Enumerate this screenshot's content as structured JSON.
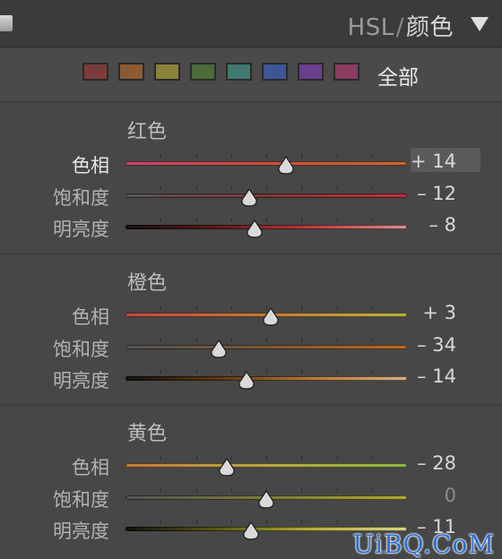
{
  "header": {
    "title_prefix": "HSL",
    "title_sep": "/",
    "title_active": "颜色",
    "collapse_icon": "triangle-down-icon"
  },
  "swatches": [
    {
      "name": "red",
      "color": "#7a3c3a"
    },
    {
      "name": "orange",
      "color": "#8a5a35"
    },
    {
      "name": "yellow",
      "color": "#8a8238"
    },
    {
      "name": "green",
      "color": "#4a6b3a"
    },
    {
      "name": "aqua",
      "color": "#3f7a70"
    },
    {
      "name": "blue",
      "color": "#3d5696"
    },
    {
      "name": "purple",
      "color": "#6a3f8c"
    },
    {
      "name": "magenta",
      "color": "#8a3d60"
    }
  ],
  "all_label": "全部",
  "sections": [
    {
      "title": "红色",
      "rows": [
        {
          "label": "色相",
          "value_text": "+ 14",
          "value": 14,
          "track": "linear-gradient(90deg,#c2466e,#c3523f,#c26a3a)",
          "active": true
        },
        {
          "label": "饱和度",
          "value_text": "– 12",
          "value": -12,
          "track": "linear-gradient(90deg,#555555,#7a3a3a,#b8333a)",
          "active": false
        },
        {
          "label": "明亮度",
          "value_text": "– 8",
          "value": -8,
          "track": "linear-gradient(90deg,#111111,#5e1b1b,#b84040,#d88f8f)",
          "active": false
        }
      ]
    },
    {
      "title": "橙色",
      "rows": [
        {
          "label": "色相",
          "value_text": "+ 3",
          "value": 3,
          "track": "linear-gradient(90deg,#c24a45,#c07c3c,#b7b24a)",
          "active": false
        },
        {
          "label": "饱和度",
          "value_text": "– 34",
          "value": -34,
          "track": "linear-gradient(90deg,#555555,#7a5a3a,#b86a28)",
          "active": false
        },
        {
          "label": "明亮度",
          "value_text": "– 14",
          "value": -14,
          "track": "linear-gradient(90deg,#111111,#5e3a12,#b87a3a,#d8b08a)",
          "active": false
        }
      ]
    },
    {
      "title": "黄色",
      "rows": [
        {
          "label": "色相",
          "value_text": "– 28",
          "value": -28,
          "track": "linear-gradient(90deg,#c07c3c,#b7a448,#8fb64a)",
          "active": false
        },
        {
          "label": "饱和度",
          "value_text": "0",
          "value": 0,
          "track": "linear-gradient(90deg,#555555,#7a7a3a,#b0a833)",
          "active": false
        },
        {
          "label": "明亮度",
          "value_text": "– 11",
          "value": -11,
          "track": "linear-gradient(90deg,#111111,#5e5a12,#b8b040,#d8d48a)",
          "active": false
        }
      ]
    }
  ],
  "watermark": "UiBQ.CoM"
}
